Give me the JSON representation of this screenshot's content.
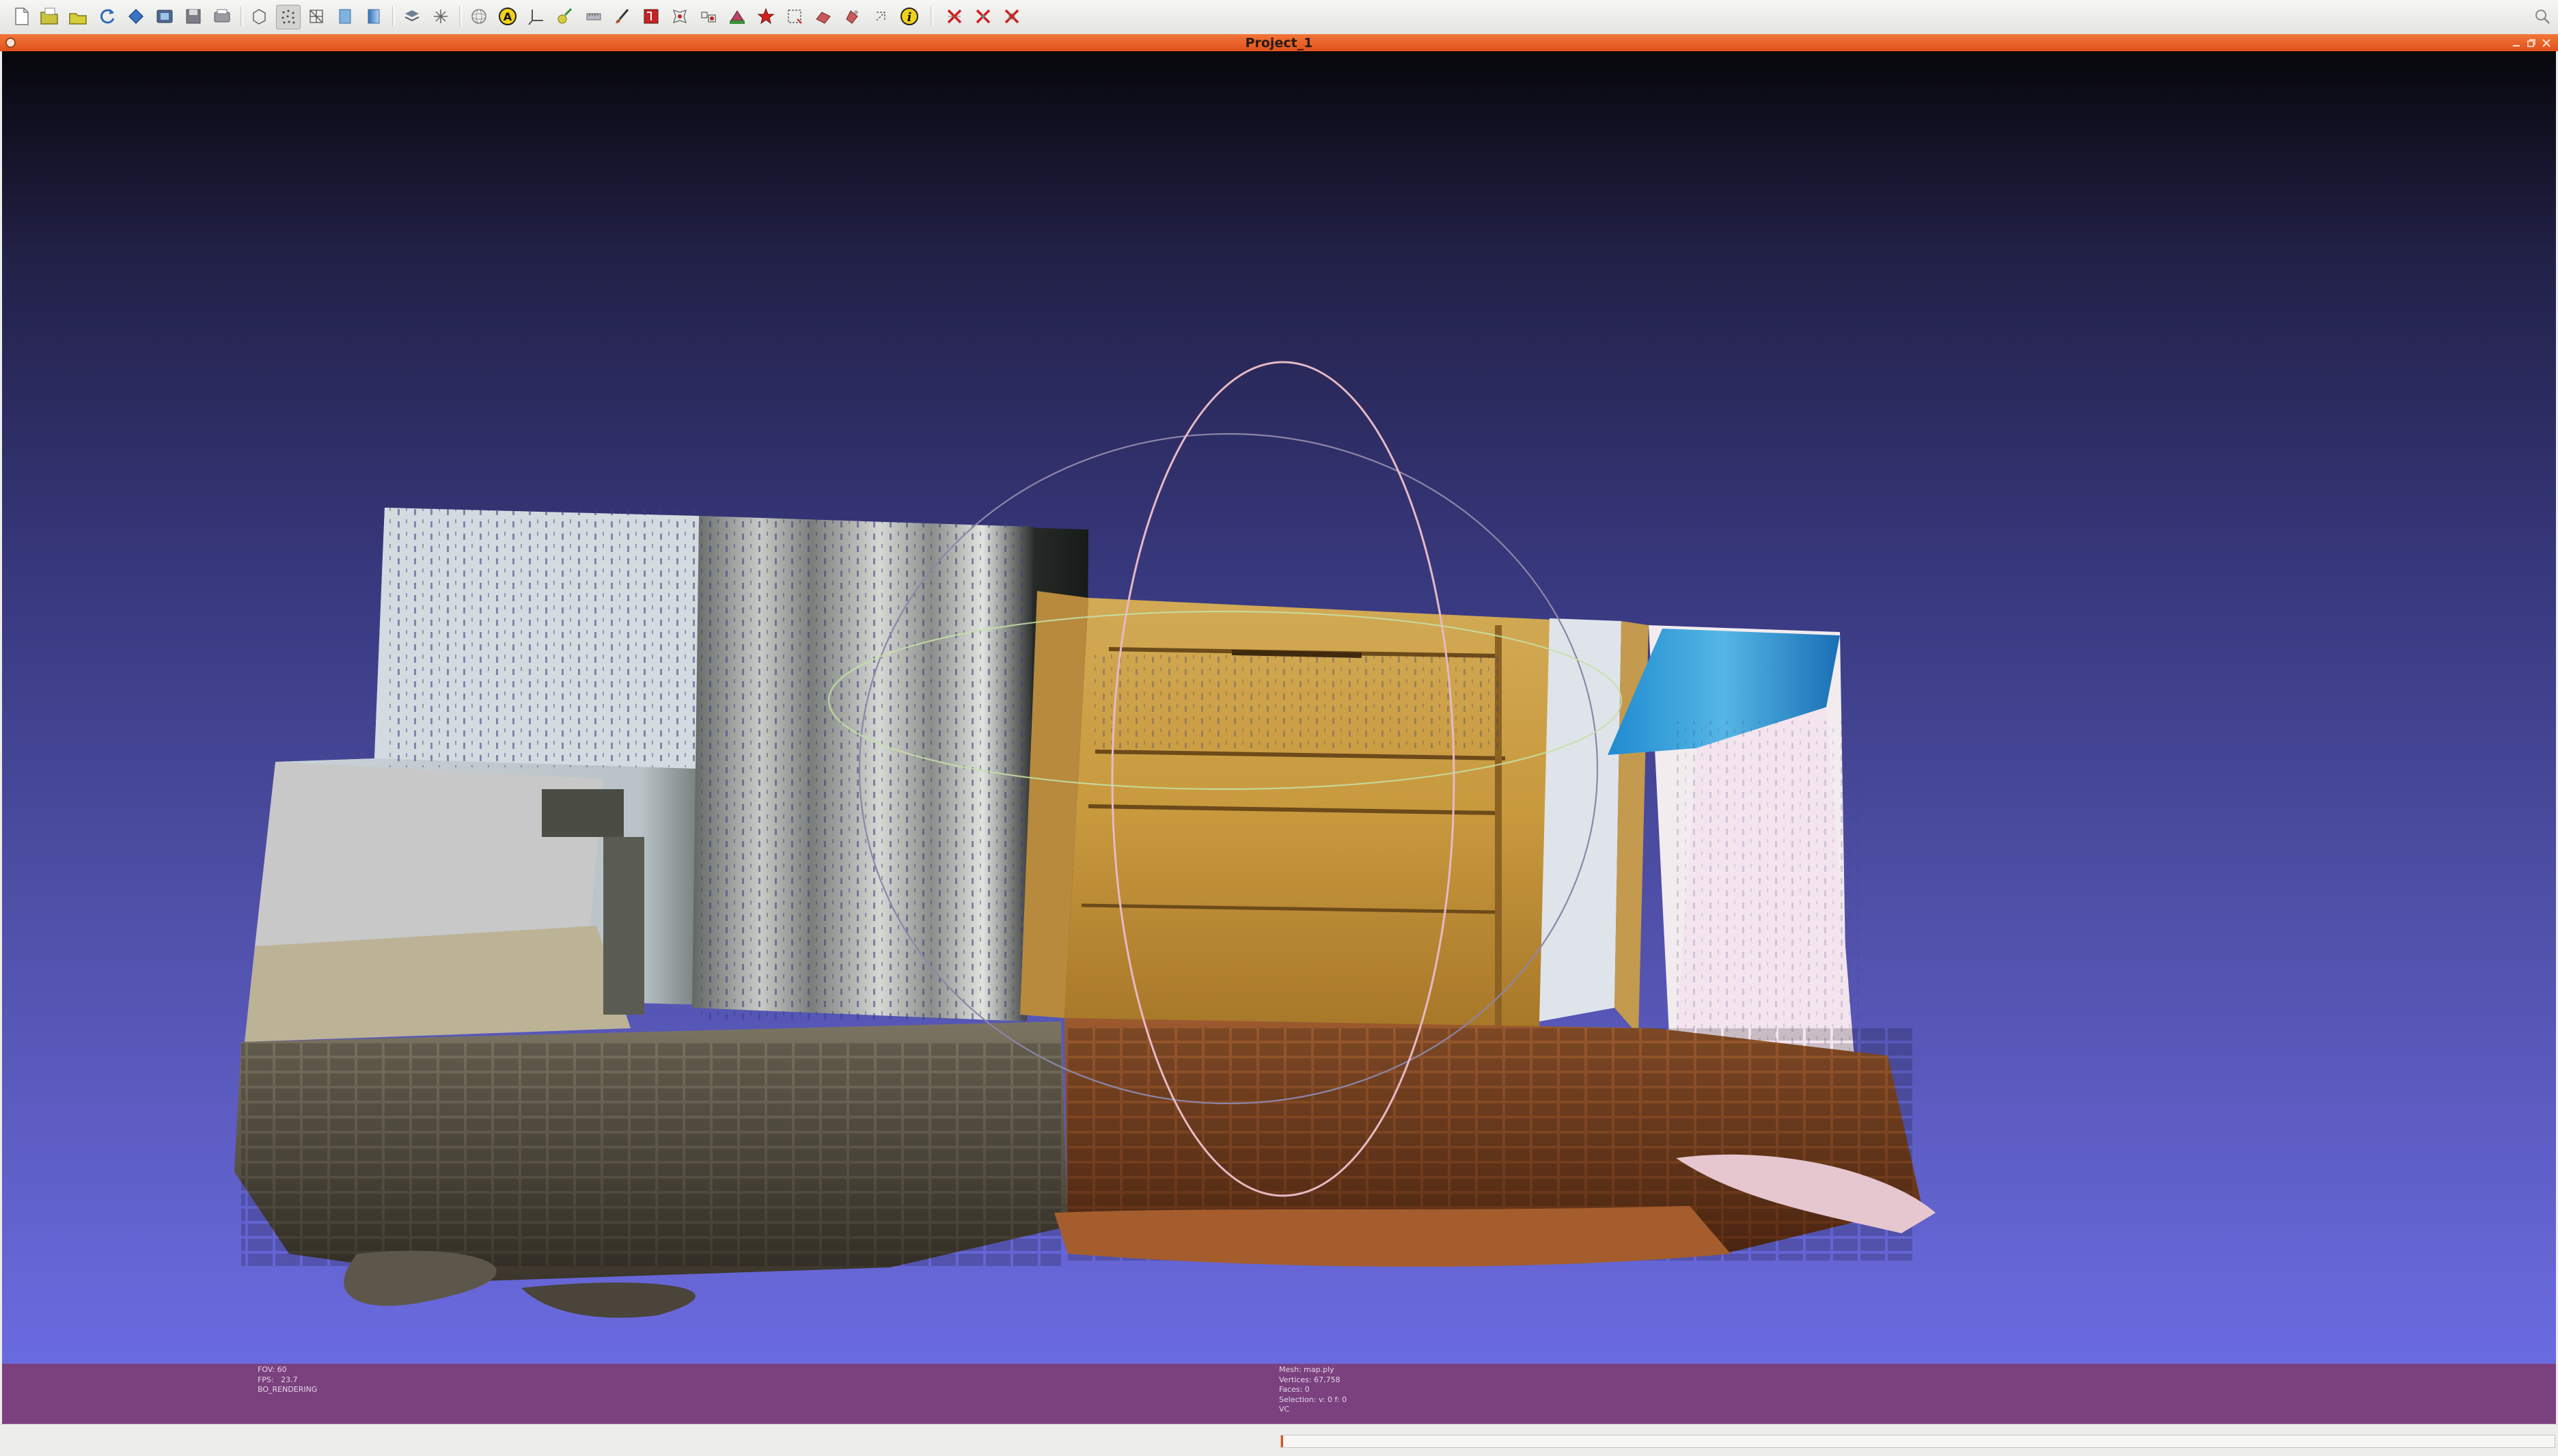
{
  "window": {
    "title": "Project_1"
  },
  "toolbar": {
    "groups": [
      [
        "new-project-icon",
        "open-project-icon",
        "open-mesh-icon",
        "reload-icon",
        "reload-all-icon",
        "snapshot-icon",
        "save-icon",
        "export-icon"
      ],
      [
        "bounding-box-icon",
        "points-render-icon",
        "wireframe-icon",
        "flat-render-icon",
        "smooth-render-icon"
      ],
      [
        "layers-icon",
        "raster-layers-icon"
      ],
      [
        "trackball-icon",
        "annotation-icon",
        "axis-icon",
        "colorize-icon",
        "measure-tool-icon",
        "paint-brush-icon",
        "select-faces-icon",
        "select-vertices-icon",
        "select-connected-icon",
        "fill-select-icon",
        "pick-points-icon",
        "select-region-icon",
        "z-paint-icon",
        "align-icon",
        "manipulator-icon",
        "info-icon"
      ],
      [
        "delete-selected-faces-icon",
        "delete-selected-vertices-icon",
        "delete-all-icon"
      ]
    ],
    "accent": "#e0511a"
  },
  "info": {
    "left": [
      "FOV: 60",
      "FPS:   23.7",
      "BO_RENDERING"
    ],
    "right": [
      "Mesh: map.ply",
      "Vertices: 67,758",
      "Faces: 0",
      "Selection: v: 0 f: 0",
      "VC"
    ]
  },
  "status": {
    "progress": 0.0
  }
}
